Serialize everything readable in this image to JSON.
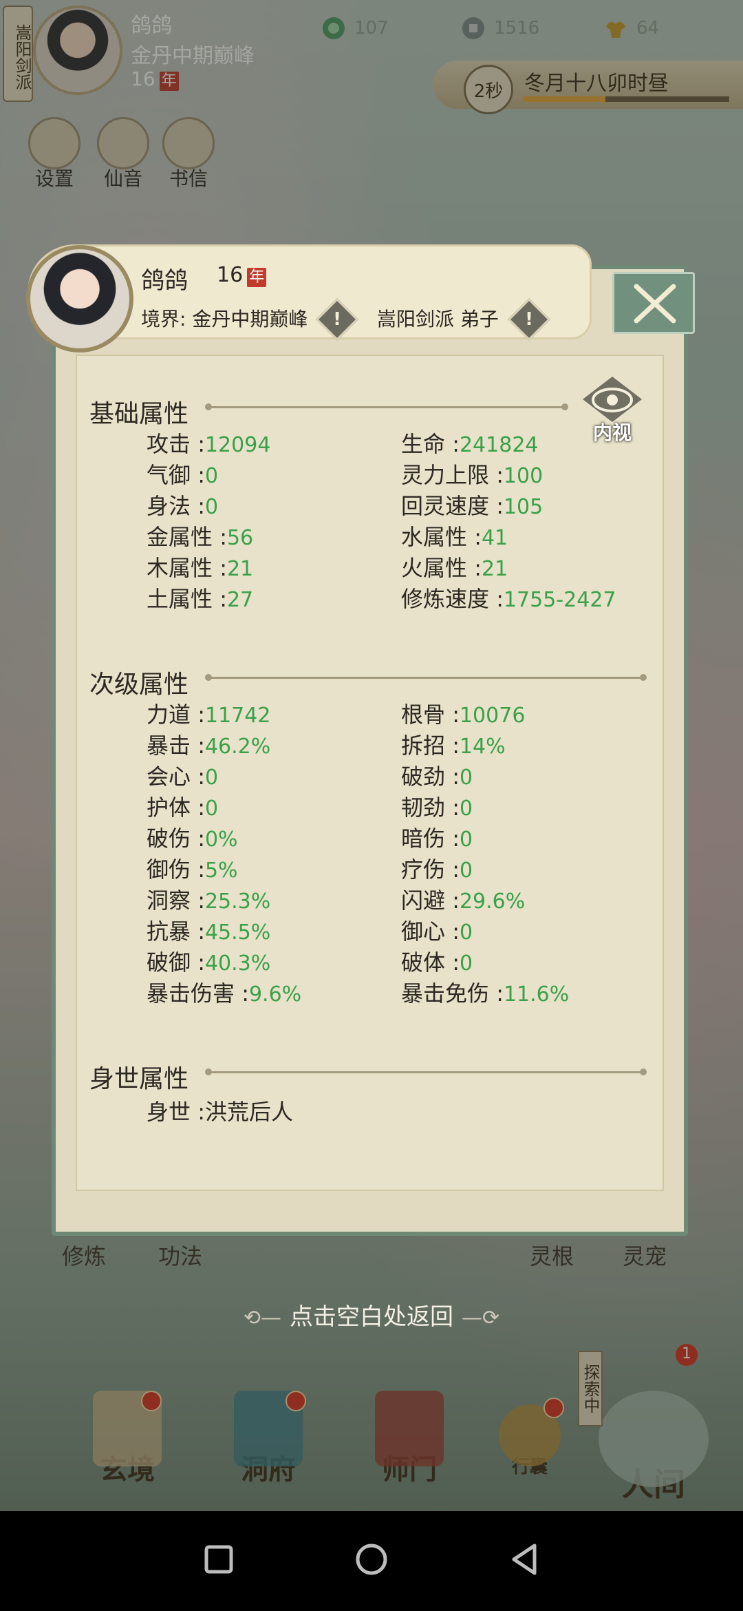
{
  "hud": {
    "sect_tag": "嵩阳剑派",
    "name": "鸽鸽",
    "realm": "金丹中期巅峰",
    "age": "16",
    "year_char": "年",
    "resources": [
      {
        "icon": "spirit-stone-icon",
        "value": "107"
      },
      {
        "icon": "coin-icon",
        "value": "1516"
      },
      {
        "icon": "strength-icon",
        "value": "64"
      }
    ],
    "time": {
      "countdown": "2秒",
      "label": "冬月十八卯时昼",
      "progress": 0.4
    },
    "buttons": [
      "设置",
      "仙音",
      "书信"
    ]
  },
  "panel": {
    "name": "鸽鸽",
    "age": "16",
    "year_char": "年",
    "realm_label": "境界",
    "realm_value": "金丹中期巅峰",
    "sect": "嵩阳剑派 弟子",
    "inner_view": "内视",
    "sections": {
      "basic": {
        "title": "基础属性",
        "left": [
          {
            "label": "攻击",
            "value": "12094"
          },
          {
            "label": "气御",
            "value": "0"
          },
          {
            "label": "身法",
            "value": "0"
          },
          {
            "label": "金属性",
            "value": "56"
          },
          {
            "label": "木属性",
            "value": "21"
          },
          {
            "label": "土属性",
            "value": "27"
          }
        ],
        "right": [
          {
            "label": "生命",
            "value": "241824"
          },
          {
            "label": "灵力上限",
            "value": "100"
          },
          {
            "label": "回灵速度",
            "value": "105"
          },
          {
            "label": "水属性",
            "value": "41"
          },
          {
            "label": "火属性",
            "value": "21"
          },
          {
            "label": "修炼速度",
            "value": "1755-2427"
          }
        ]
      },
      "secondary": {
        "title": "次级属性",
        "left": [
          {
            "label": "力道",
            "value": "11742"
          },
          {
            "label": "暴击",
            "value": "46.2%"
          },
          {
            "label": "会心",
            "value": "0"
          },
          {
            "label": "护体",
            "value": "0"
          },
          {
            "label": "破伤",
            "value": "0%"
          },
          {
            "label": "御伤",
            "value": "5%"
          },
          {
            "label": "洞察",
            "value": "25.3%"
          },
          {
            "label": "抗暴",
            "value": "45.5%"
          },
          {
            "label": "破御",
            "value": "40.3%"
          },
          {
            "label": "暴击伤害",
            "value": "9.6%"
          }
        ],
        "right": [
          {
            "label": "根骨",
            "value": "10076"
          },
          {
            "label": "拆招",
            "value": "14%"
          },
          {
            "label": "破劲",
            "value": "0"
          },
          {
            "label": "韧劲",
            "value": "0"
          },
          {
            "label": "暗伤",
            "value": "0"
          },
          {
            "label": "疗伤",
            "value": "0"
          },
          {
            "label": "闪避",
            "value": "29.6%"
          },
          {
            "label": "御心",
            "value": "0"
          },
          {
            "label": "破体",
            "value": "0"
          },
          {
            "label": "暴击免伤",
            "value": "11.6%"
          }
        ]
      },
      "origin": {
        "title": "身世属性",
        "label": "身世",
        "value": "洪荒后人"
      }
    }
  },
  "tabs_peek": [
    "修炼",
    "功法",
    "",
    "",
    "",
    "灵根",
    "灵宠"
  ],
  "return_hint": "点击空白处返回",
  "explore": {
    "label": "探索中",
    "count": "1"
  },
  "bottom_nav": [
    "玄境",
    "洞府",
    "师门",
    "行囊",
    "人间"
  ],
  "colors": {
    "value_green": "#3aa04a",
    "panel_border": "#6e8a76",
    "badge_red": "#c23a2b"
  }
}
